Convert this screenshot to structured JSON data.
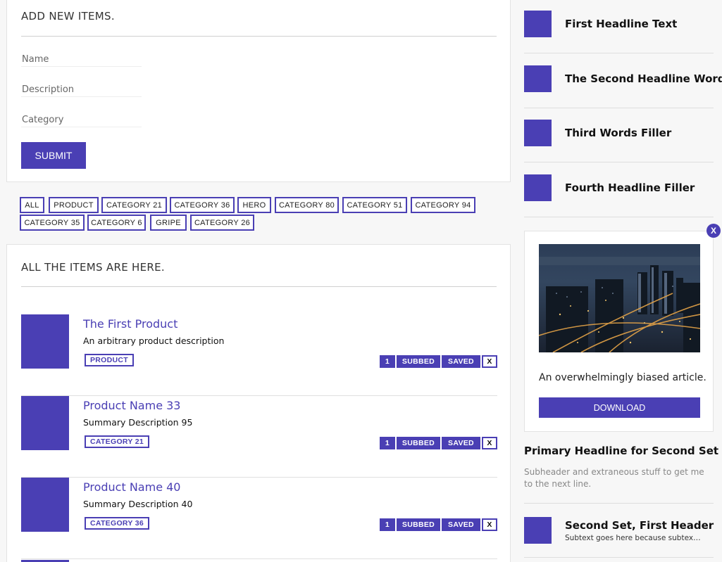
{
  "add_panel": {
    "title": "ADD NEW ITEMS.",
    "fields": [
      {
        "placeholder": "Name"
      },
      {
        "placeholder": "Description"
      },
      {
        "placeholder": "Category"
      }
    ],
    "submit_label": "SUBMIT"
  },
  "tags": [
    {
      "label": "ALL"
    },
    {
      "label": "PRODUCT"
    },
    {
      "label": "CATEGORY 21"
    },
    {
      "label": "CATEGORY 36"
    },
    {
      "label": "HERO"
    },
    {
      "label": "CATEGORY 80"
    },
    {
      "label": "CATEGORY 51"
    },
    {
      "label": "CATEGORY 94"
    },
    {
      "label": "CATEGORY 35"
    },
    {
      "label": "CATEGORY 6"
    },
    {
      "label": "GRIPE"
    },
    {
      "label": "CATEGORY 26"
    }
  ],
  "items_panel": {
    "title": "ALL THE ITEMS ARE HERE.",
    "items": [
      {
        "name": "The First Product",
        "description": "An arbitrary product description",
        "tag": "PRODUCT",
        "count": "1",
        "subbed": "SUBBED",
        "saved": "SAVED",
        "remove": "X"
      },
      {
        "name": "Product Name 33",
        "description": "Summary Description 95",
        "tag": "CATEGORY 21",
        "count": "1",
        "subbed": "SUBBED",
        "saved": "SAVED",
        "remove": "X"
      },
      {
        "name": "Product Name 40",
        "description": "Summary Description 40",
        "tag": "CATEGORY 36",
        "count": "1",
        "subbed": "SUBBED",
        "saved": "SAVED",
        "remove": "X"
      }
    ]
  },
  "sidebar": {
    "headlines": [
      {
        "text": "First Headline Text"
      },
      {
        "text": "The Second Headline Words"
      },
      {
        "text": "Third Words Filler"
      },
      {
        "text": "Fourth Headline Filler"
      }
    ],
    "ad": {
      "close_label": "X",
      "text": "An overwhelmingly biased article.",
      "button_label": "DOWNLOAD"
    },
    "second_set": {
      "headline": "Primary Headline for Second Set",
      "subheader": "Subheader and extraneous stuff to get me to the next line.",
      "first_item_title": "Second Set, First Header",
      "first_item_sub": "Subtext goes here because subtext is needed"
    }
  },
  "colors": {
    "accent": "#4a3fb4",
    "background": "#f7f7f7"
  }
}
